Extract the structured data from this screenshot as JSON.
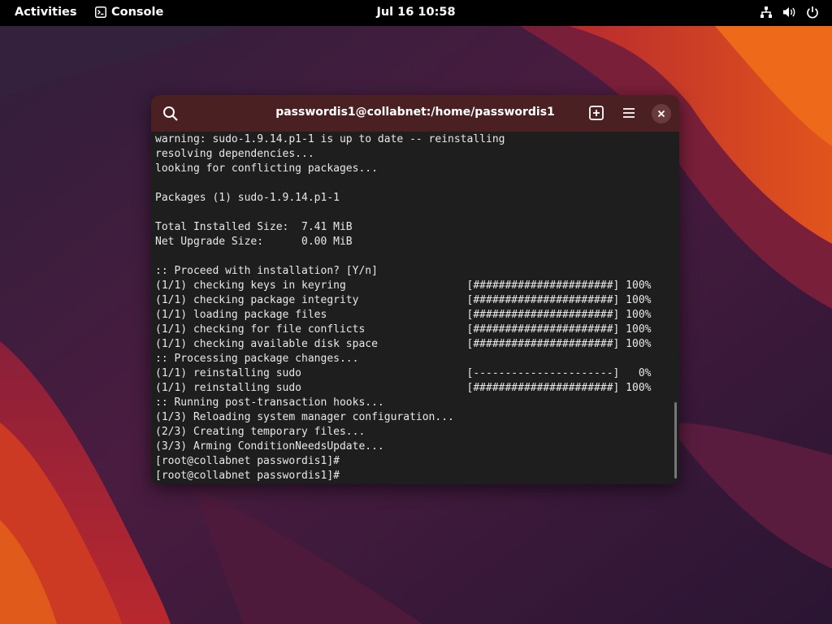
{
  "topbar": {
    "activities_label": "Activities",
    "app_name": "Console",
    "clock": "Jul 16  10:58"
  },
  "window": {
    "title": "passwordis1@collabnet:/home/passwordis1"
  },
  "terminal": {
    "lines": [
      "warning: sudo-1.9.14.p1-1 is up to date -- reinstalling",
      "resolving dependencies...",
      "looking for conflicting packages...",
      "",
      "Packages (1) sudo-1.9.14.p1-1",
      "",
      "Total Installed Size:  7.41 MiB",
      "Net Upgrade Size:      0.00 MiB",
      "",
      ":: Proceed with installation? [Y/n]",
      "(1/1) checking keys in keyring                   [######################] 100%",
      "(1/1) checking package integrity                 [######################] 100%",
      "(1/1) loading package files                      [######################] 100%",
      "(1/1) checking for file conflicts                [######################] 100%",
      "(1/1) checking available disk space              [######################] 100%",
      ":: Processing package changes...",
      "(1/1) reinstalling sudo                          [----------------------]   0%",
      "(1/1) reinstalling sudo                          [######################] 100%",
      ":: Running post-transaction hooks...",
      "(1/3) Reloading system manager configuration...",
      "(2/3) Creating temporary files...",
      "(3/3) Arming ConditionNeedsUpdate...",
      "[root@collabnet passwordis1]#",
      "[root@collabnet passwordis1]#"
    ]
  },
  "icons": {
    "terminal": "terminal-icon",
    "network": "network-icon",
    "volume": "volume-icon",
    "power": "power-icon",
    "search": "search-icon",
    "new_tab": "new-tab-icon",
    "menu": "hamburger-menu-icon",
    "close": "close-icon"
  },
  "colors": {
    "topbar_bg": "#000000",
    "headerbar_bg": "#4a2022",
    "terminal_bg": "#1e1e1e",
    "terminal_fg": "#e8e8e8"
  }
}
